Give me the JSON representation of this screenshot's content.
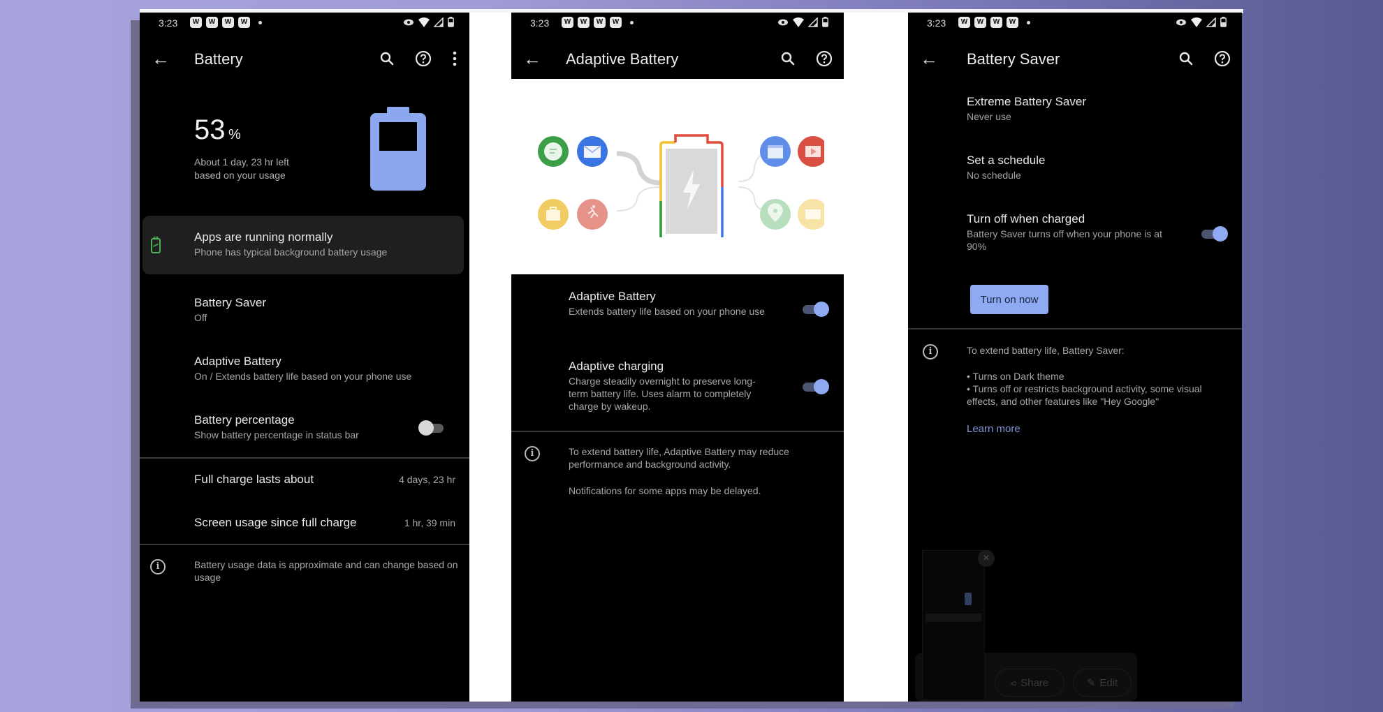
{
  "status_bar": {
    "time": "3:23",
    "notification_icons": [
      "W",
      "W",
      "W",
      "W"
    ],
    "right_icons": [
      "eye-icon",
      "wifi-icon",
      "signal-icon",
      "battery-icon"
    ]
  },
  "screens": {
    "battery": {
      "title": "Battery",
      "header_icons": [
        "search-icon",
        "help-icon",
        "more-vert-icon"
      ],
      "percent_value": "53",
      "percent_unit": "%",
      "level": 0.53,
      "estimate_line1": "About 1 day, 23 hr left",
      "estimate_line2": "based on your usage",
      "battery_color": "#8ba8ee",
      "tip_card": {
        "title": "Apps are running normally",
        "subtitle": "Phone has typical background battery usage",
        "icon_color": "#4caf50"
      },
      "items": [
        {
          "title": "Battery Saver",
          "subtitle": "Off"
        },
        {
          "title": "Adaptive Battery",
          "subtitle": "On / Extends battery life based on your phone use"
        },
        {
          "title": "Battery percentage",
          "subtitle": "Show battery percentage in status bar",
          "toggle": false
        }
      ],
      "stats": [
        {
          "label": "Full charge lasts about",
          "value": "4 days, 23 hr"
        },
        {
          "label": "Screen usage since full charge",
          "value": "1 hr, 39 min"
        }
      ],
      "footer_info": "Battery usage data is approximate and can change based on usage"
    },
    "adaptive_battery": {
      "title": "Adaptive Battery",
      "header_icons": [
        "search-icon",
        "help-icon"
      ],
      "illustration": {
        "left_apps": [
          "messages-icon",
          "email-icon",
          "briefcase-icon",
          "fitness-icon"
        ],
        "right_apps": [
          "calendar-icon",
          "video-icon",
          "maps-icon",
          "photos-icon"
        ],
        "center": "charging-battery-icon"
      },
      "items": [
        {
          "title": "Adaptive Battery",
          "subtitle": "Extends battery life based on your phone use",
          "toggle": true
        },
        {
          "title": "Adaptive charging",
          "subtitle": "Charge steadily overnight to preserve long-term battery life. Uses alarm to completely charge by wakeup.",
          "toggle": true
        }
      ],
      "footer_info_1": "To extend battery life, Adaptive Battery may reduce performance and background activity.",
      "footer_info_2": "Notifications for some apps may be delayed."
    },
    "battery_saver": {
      "title": "Battery Saver",
      "header_icons": [
        "search-icon",
        "help-icon"
      ],
      "items": [
        {
          "title": "Extreme Battery Saver",
          "subtitle": "Never use"
        },
        {
          "title": "Set a schedule",
          "subtitle": "No schedule"
        },
        {
          "title": "Turn off when charged",
          "subtitle": "Battery Saver turns off when your phone is at 90%",
          "toggle": true
        }
      ],
      "button_label": "Turn on now",
      "button_color": "#8fa9f2",
      "info_heading": "To extend battery life, Battery Saver:",
      "info_bullets": [
        "• Turns on Dark theme",
        "• Turns off or restricts background activity, some visual effects, and other features like \"Hey Google\""
      ],
      "learn_more": "Learn more",
      "screenshot_overlay": {
        "share_label": "Share",
        "edit_label": "Edit"
      }
    }
  }
}
